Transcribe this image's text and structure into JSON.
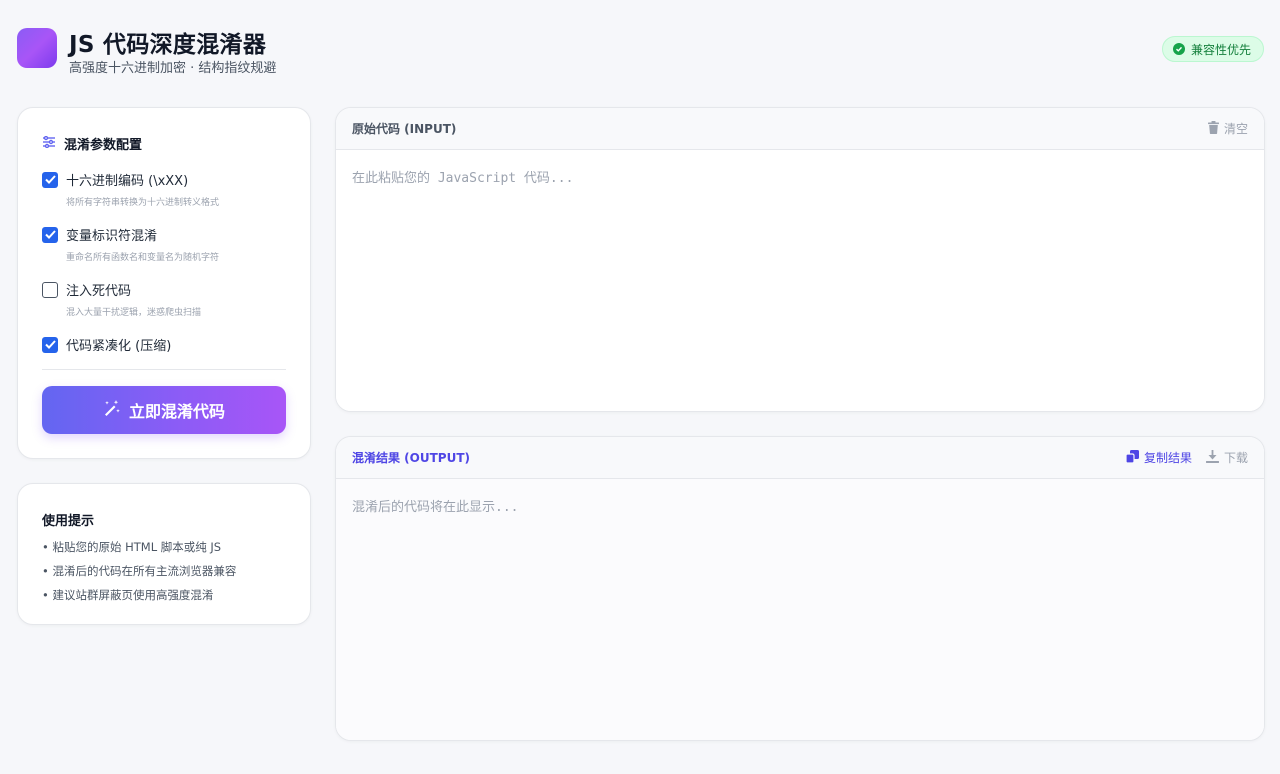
{
  "header": {
    "title": "JS 代码深度混淆器",
    "subtitle": "高强度十六进制加密 · 结构指纹规避",
    "badge": "兼容性优先"
  },
  "config": {
    "title": "混淆参数配置",
    "options": [
      {
        "label": "十六进制编码 (\\xXX)",
        "desc": "将所有字符串转换为十六进制转义格式",
        "checked": true
      },
      {
        "label": "变量标识符混淆",
        "desc": "重命名所有函数名和变量名为随机字符",
        "checked": true
      },
      {
        "label": "注入死代码",
        "desc": "混入大量干扰逻辑，迷惑爬虫扫描",
        "checked": false
      },
      {
        "label": "代码紧凑化 (压缩)",
        "desc": "",
        "checked": true
      }
    ],
    "button": "立即混淆代码"
  },
  "tips": {
    "title": "使用提示",
    "items": [
      "• 粘贴您的原始 HTML 脚本或纯 JS",
      "• 混淆后的代码在所有主流浏览器兼容",
      "• 建议站群屏蔽页使用高强度混淆"
    ]
  },
  "input": {
    "title": "原始代码 (INPUT)",
    "clear": "清空",
    "placeholder": "在此粘贴您的 JavaScript 代码..."
  },
  "output": {
    "title": "混淆结果 (OUTPUT)",
    "copy": "复制结果",
    "download": "下载",
    "placeholder": "混淆后的代码将在此显示..."
  },
  "colors": {
    "accent": "#4f46e5",
    "checkbox": "#2563eb",
    "badge_bg": "#dcfce7",
    "badge_text": "#15803d"
  }
}
